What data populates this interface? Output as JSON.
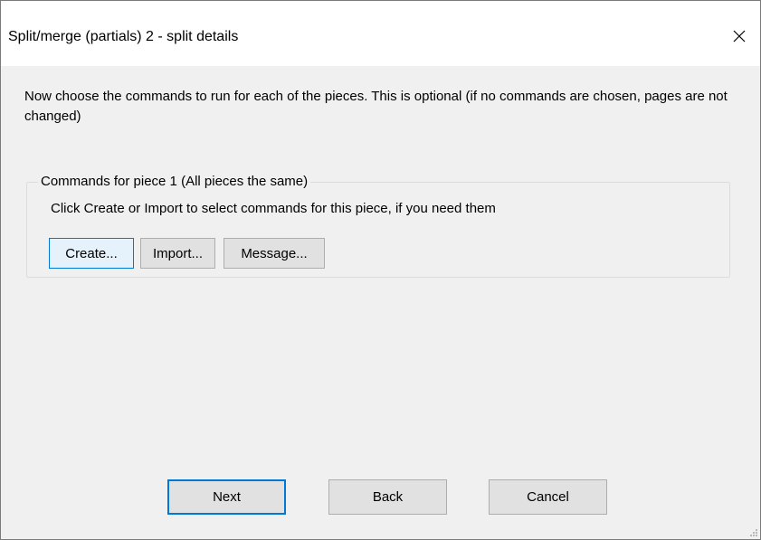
{
  "window": {
    "title": "Split/merge (partials) 2 - split details"
  },
  "main": {
    "intro_text": "Now choose the commands to run for each of the pieces. This is optional (if no commands are chosen, pages are not changed)"
  },
  "group": {
    "legend": "Commands for piece 1 (All pieces the same)",
    "hint": "Click Create or Import to select commands for this piece, if you need them",
    "buttons": {
      "create": "Create...",
      "import": "Import...",
      "message": "Message..."
    }
  },
  "footer": {
    "next": "Next",
    "back": "Back",
    "cancel": "Cancel"
  },
  "colors": {
    "accent": "#0078d7",
    "button_face": "#e1e1e1",
    "dialog_bg": "#f0f0f0"
  },
  "icons": {
    "close": "close-icon",
    "resize": "resize-grip-icon"
  }
}
